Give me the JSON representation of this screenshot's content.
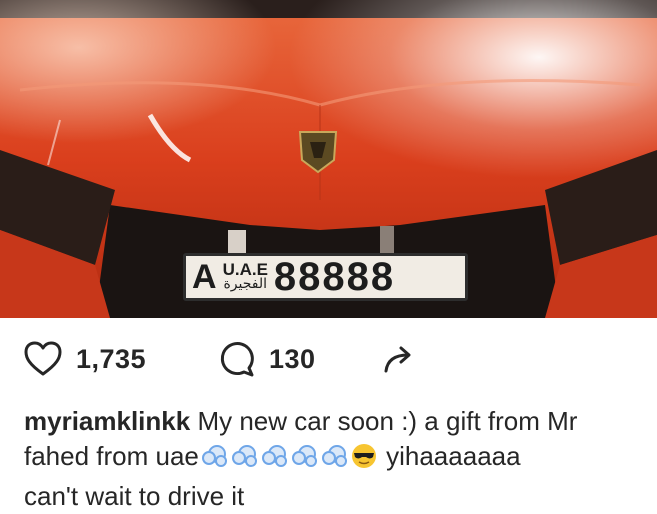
{
  "post": {
    "plate": {
      "letter": "A",
      "country": "U.A.E",
      "emirate_arabic": "الفجيرة",
      "number": "88888"
    },
    "likes": "1,735",
    "comments": "130",
    "icons": [
      "heart-icon",
      "comment-icon",
      "share-icon"
    ],
    "caption": {
      "username": "myriamklinkk",
      "text_line1": " My new car soon :) a gift from Mr",
      "text_line2": "fahed  from uae",
      "emojis": [
        "dash-icon",
        "dash-icon",
        "dash-icon",
        "dash-icon",
        "dash-icon",
        "sunglasses-face-icon"
      ],
      "text_after_emojis": " yihaaaaaaa",
      "text_line3": "can't wait to drive it"
    },
    "colors": {
      "car_orange": "#d9391a",
      "text": "#262626",
      "emoji_blue": "#6fa6e8",
      "emoji_yellow": "#f7c531"
    }
  }
}
